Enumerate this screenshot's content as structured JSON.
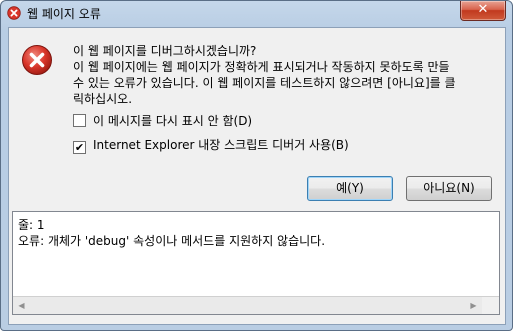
{
  "window": {
    "title": "웹 페이지 오류",
    "close_label": "✕"
  },
  "message": {
    "line1": "이 웹 페이지를 디버그하시겠습니까?",
    "line2": "이 웹 페이지에는 웹 페이지가 정확하게 표시되거나 작동하지 못하도록 만들",
    "line3": "수 있는 오류가 있습니다. 이 웹 페이지를 테스트하지 않으려면 [아니요]를 클",
    "line4": "릭하십시오."
  },
  "options": {
    "dont_show": {
      "label": "이 메시지를 다시 표시 안 함(D)",
      "checked": false
    },
    "use_debugger": {
      "label": "Internet Explorer 내장 스크립트 디버거 사용(B)",
      "checked": true
    }
  },
  "buttons": {
    "yes": "예(Y)",
    "no": "아니요(N)"
  },
  "details": {
    "line": "줄: 1",
    "error": "오류: 개체가 'debug' 속성이나 메서드를 지원하지 않습니다."
  },
  "colors": {
    "error_icon": "#d9362b",
    "close_button": "#c7432a"
  },
  "icons": {
    "title": "error-icon",
    "main": "error-icon"
  }
}
